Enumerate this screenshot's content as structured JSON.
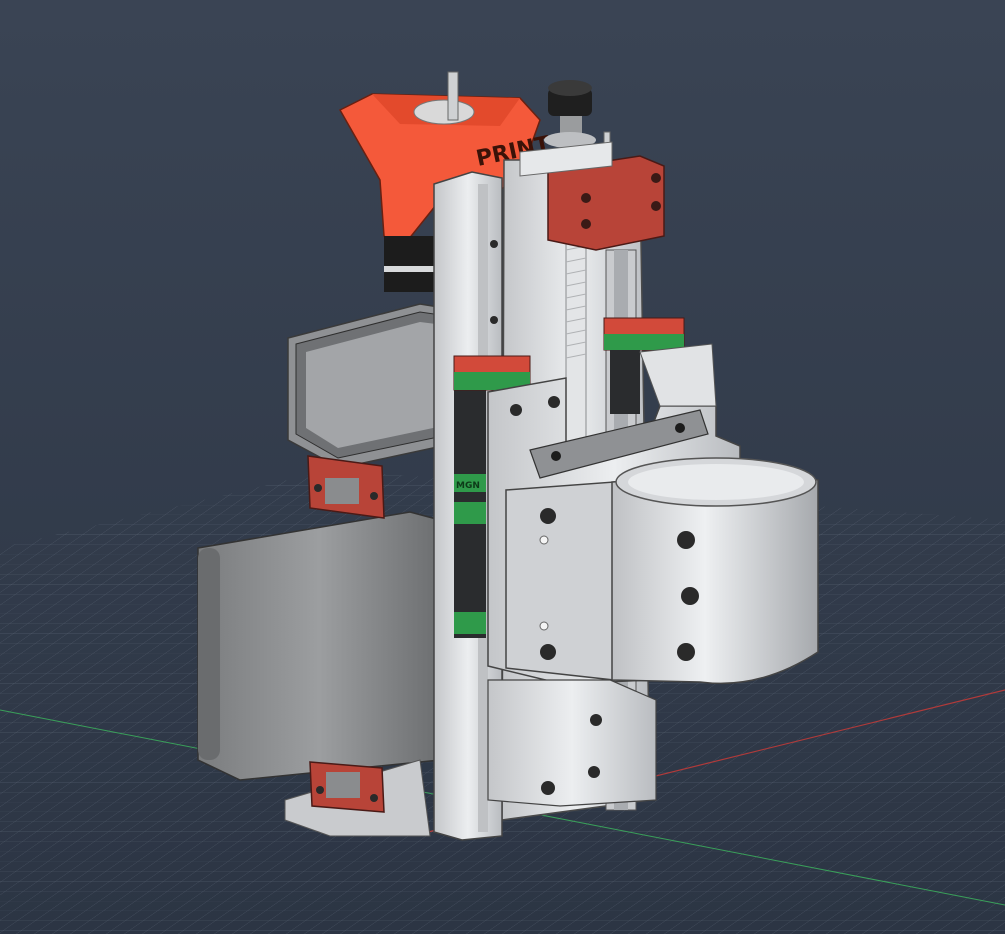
{
  "scene": {
    "background_top": "#3a4454",
    "background_bottom": "#2c3544",
    "grid_color": "#8a96a8",
    "axis_x_color": "#b03a3a",
    "axis_y_color": "#3aa05a"
  },
  "colors": {
    "printed_orange": "#f4593a",
    "printed_red": "#b84438",
    "aluminum": "#d8dadc",
    "aluminum_dark": "#a9acb0",
    "steel_gray": "#8c8e90",
    "rail_dark": "#2a2c2e",
    "carriage_green": "#2f9a4a",
    "motor_black": "#1c1c1c"
  },
  "labels": {
    "orange_mount_text": "PRINT",
    "rail_carriage_text": "MGN"
  },
  "icons": {
    "spindle_clamp": "cylinder-clamp-icon",
    "timing_pulley": "pulley-icon",
    "lead_screw": "lead-screw-icon"
  }
}
